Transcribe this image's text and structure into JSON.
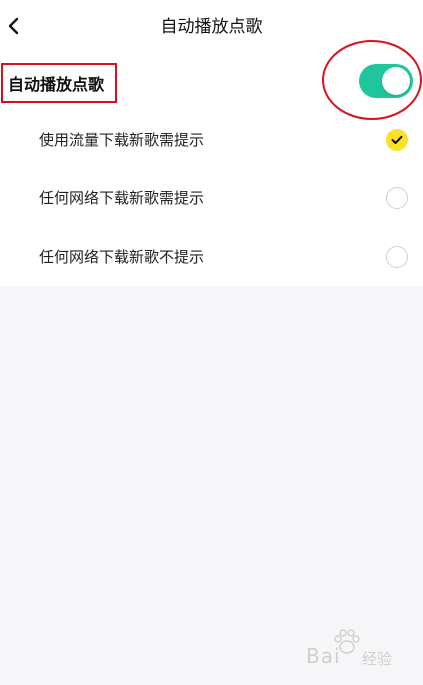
{
  "header": {
    "title": "自动播放点歌"
  },
  "main_setting": {
    "label": "自动播放点歌",
    "enabled": true
  },
  "options": [
    {
      "label": "使用流量下载新歌需提示",
      "selected": true
    },
    {
      "label": "任何网络下载新歌需提示",
      "selected": false
    },
    {
      "label": "任何网络下载新歌不提示",
      "selected": false
    }
  ],
  "watermark": {
    "text": "Bai",
    "sub": "经验"
  },
  "colors": {
    "toggle_on": "#1fc69c",
    "radio_checked": "#fbe028",
    "annotation_red": "#d9111c",
    "background": "#f6f6f8"
  }
}
